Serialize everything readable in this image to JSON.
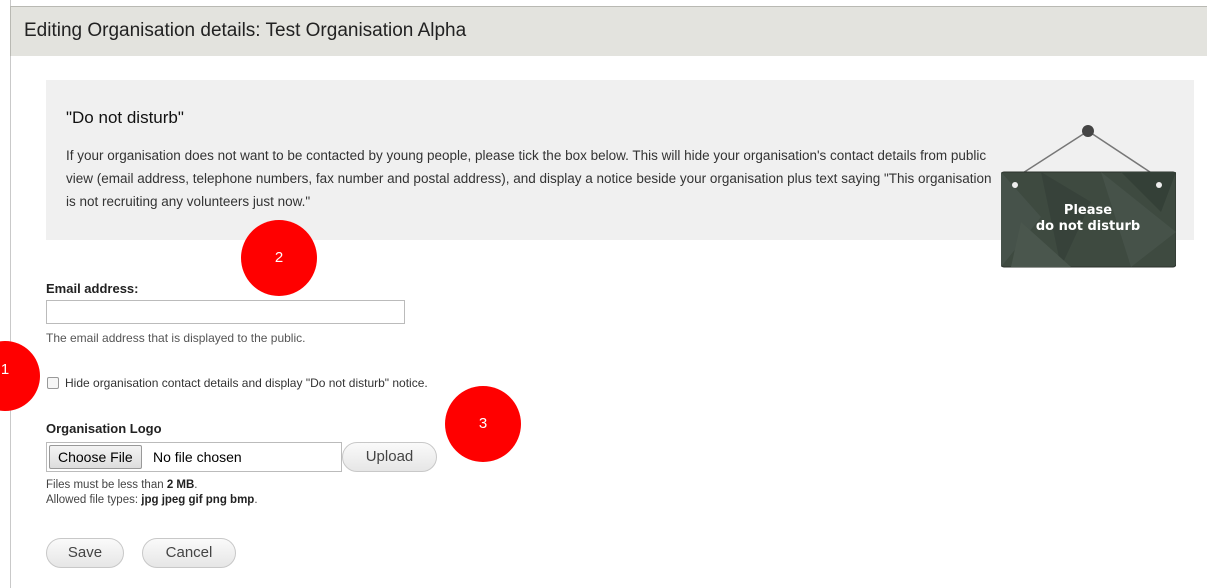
{
  "header": {
    "title": "Editing Organisation details: Test Organisation Alpha"
  },
  "notice": {
    "title": "\"Do not disturb\"",
    "text": "If your organisation does not want to be contacted by young people, please tick the box below. This will hide your organisation's contact details from public view (email address, telephone numbers, fax number and postal address), and display a notice beside your organisation plus text saying \"This organisation is not recruiting any volunteers just now.\"",
    "sign_line1": "Please",
    "sign_line2": "do not disturb"
  },
  "email": {
    "label": "Email address:",
    "value": "",
    "description": "The email address that is displayed to the public."
  },
  "hide_contact": {
    "checked": false,
    "label": "Hide organisation contact details and display \"Do not disturb\" notice."
  },
  "logo": {
    "label": "Organisation Logo",
    "choose_button": "Choose File",
    "status": "No file chosen",
    "upload_button": "Upload",
    "size_prefix": "Files must be less than ",
    "size_value": "2 MB",
    "size_suffix": ".",
    "types_prefix": "Allowed file types: ",
    "types_value": "jpg jpeg gif png bmp",
    "types_suffix": "."
  },
  "actions": {
    "save": "Save",
    "cancel": "Cancel"
  },
  "markers": [
    "1",
    "2",
    "3"
  ],
  "colors": {
    "marker": "#ff0000",
    "titlebar_bg": "#e3e3de",
    "notice_bg": "#f0f0f0",
    "sign_board": "#3e4a40"
  }
}
